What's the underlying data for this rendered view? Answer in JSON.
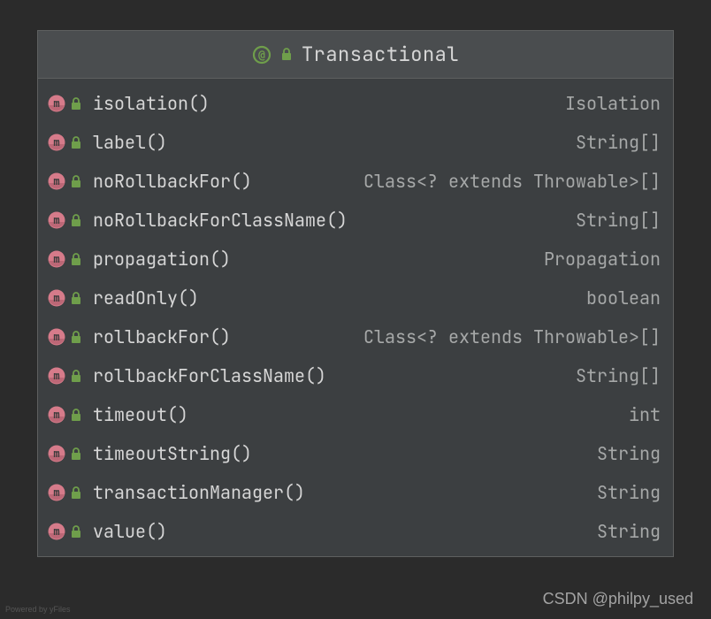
{
  "header": {
    "title": "Transactional"
  },
  "methods": [
    {
      "name": "isolation()",
      "returnType": "Isolation"
    },
    {
      "name": "label()",
      "returnType": "String[]"
    },
    {
      "name": "noRollbackFor()",
      "returnType": "Class<? extends Throwable>[]"
    },
    {
      "name": "noRollbackForClassName()",
      "returnType": "String[]"
    },
    {
      "name": "propagation()",
      "returnType": "Propagation"
    },
    {
      "name": "readOnly()",
      "returnType": "boolean"
    },
    {
      "name": "rollbackFor()",
      "returnType": "Class<? extends Throwable>[]"
    },
    {
      "name": "rollbackForClassName()",
      "returnType": "String[]"
    },
    {
      "name": "timeout()",
      "returnType": "int"
    },
    {
      "name": "timeoutString()",
      "returnType": "String"
    },
    {
      "name": "transactionManager()",
      "returnType": "String"
    },
    {
      "name": "value()",
      "returnType": "String"
    }
  ],
  "footer": {
    "left": "Powered by yFiles",
    "right": "CSDN @philpy_used"
  },
  "colors": {
    "methodBadge": "#d67b8a",
    "methodBadgeDark": "#a85866",
    "lock": "#6f9e4b",
    "annotation": "#6f9e4b"
  }
}
